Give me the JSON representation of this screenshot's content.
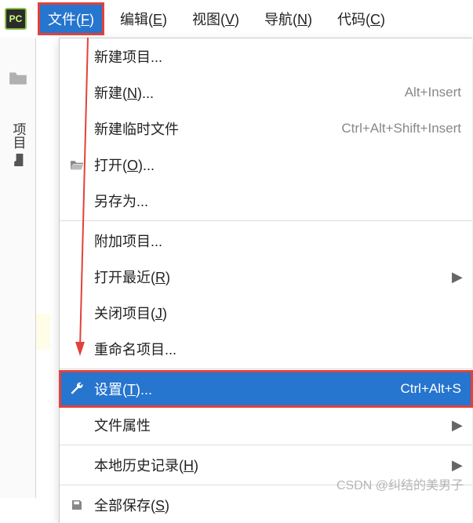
{
  "menubar": {
    "file": "文件(F)",
    "edit": "编辑(E)",
    "view": "视图(V)",
    "navigate": "导航(N)",
    "code": "代码(C)"
  },
  "sidebar": {
    "project_label": "项目"
  },
  "file_menu": {
    "new_project": "新建项目...",
    "new": "新建(N)...",
    "new_shortcut": "Alt+Insert",
    "new_scratch": "新建临时文件",
    "new_scratch_shortcut": "Ctrl+Alt+Shift+Insert",
    "open": "打开(O)...",
    "save_as": "另存为...",
    "attach_project": "附加项目...",
    "open_recent": "打开最近(R)",
    "close_project": "关闭项目(J)",
    "rename_project": "重命名项目...",
    "settings": "设置(T)...",
    "settings_shortcut": "Ctrl+Alt+S",
    "file_properties": "文件属性",
    "local_history": "本地历史记录(H)",
    "save_all": "全部保存(S)"
  },
  "watermark": "CSDN @纠结的美男子"
}
